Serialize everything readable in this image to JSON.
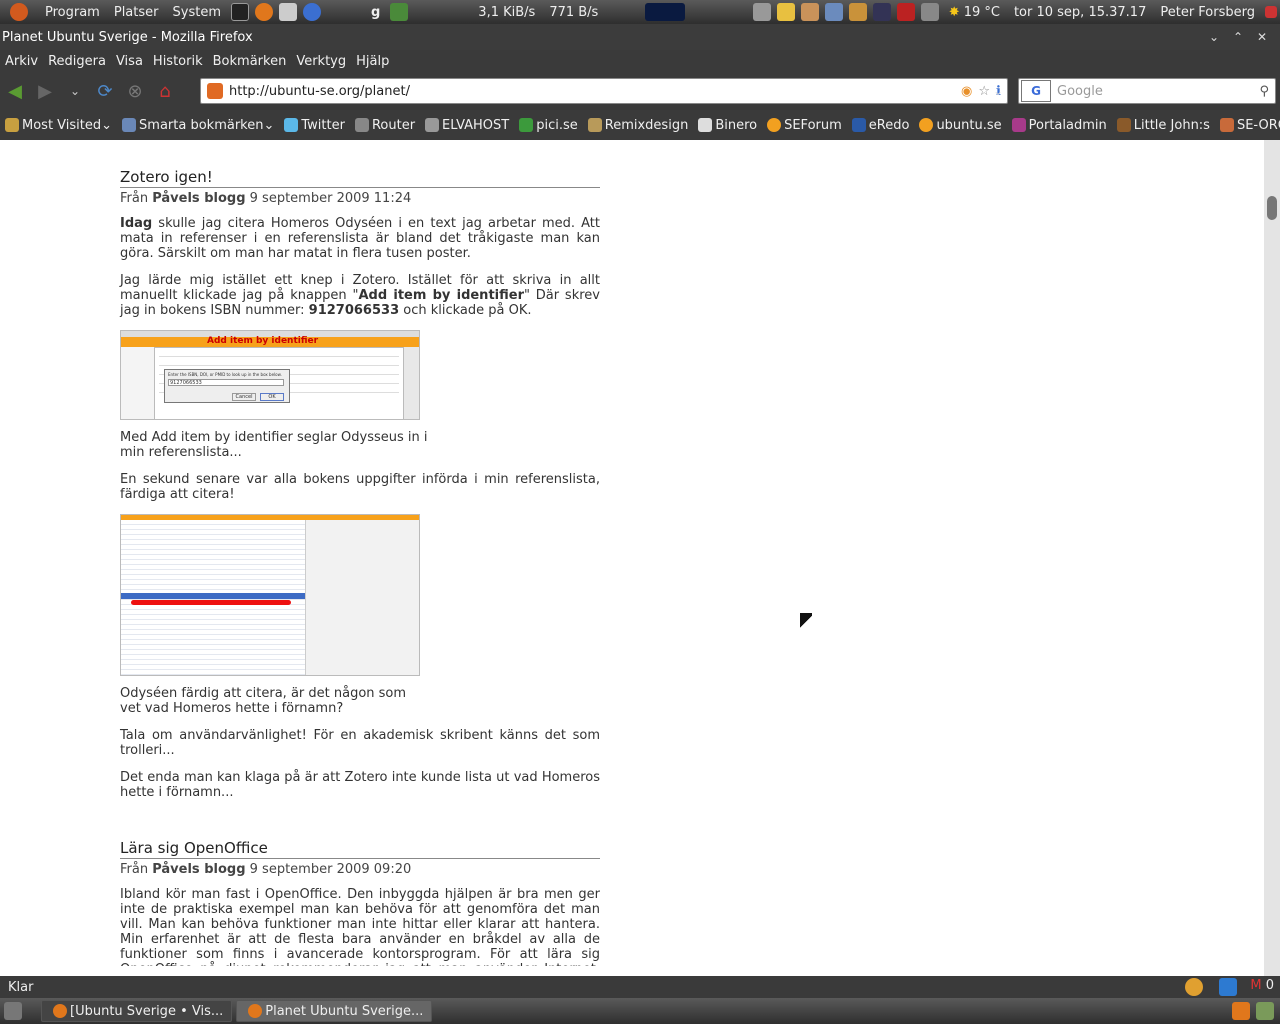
{
  "top_panel": {
    "menu_program": "Program",
    "menu_places": "Platser",
    "menu_system": "System",
    "net_down": "3,1 KiB/s",
    "net_up": "771 B/s",
    "weather": "19 °C",
    "clock": "tor 10 sep, 15.37.17",
    "user": "Peter Forsberg"
  },
  "window": {
    "title": "Planet Ubuntu Sverige - Mozilla Firefox"
  },
  "menubar": {
    "items": [
      "Arkiv",
      "Redigera",
      "Visa",
      "Historik",
      "Bokmärken",
      "Verktyg",
      "Hjälp"
    ]
  },
  "navbar": {
    "url": "http://ubuntu-se.org/planet/",
    "search_placeholder": "Google"
  },
  "bookmarks": [
    "Most Visited",
    "Smarta bokmärken",
    "Twitter",
    "Router",
    "ELVAHOST",
    "pici.se",
    "Remixdesign",
    "Binero",
    "SEForum",
    "eRedo",
    "ubuntu.se",
    "Portaladmin",
    "Little John:s",
    "SE-ORG"
  ],
  "posts": [
    {
      "title": "Zotero igen!",
      "from": "Från",
      "author": "Påvels blogg",
      "date": "9 september 2009 11:24",
      "p1_lead": "Idag",
      "p1": " skulle jag citera Homeros Odyséen i en text jag arbetar med. Att mata in referenser i en referenslista är bland det tråkigaste man kan göra. Särskilt om man har matat in flera tusen poster.",
      "p2a": "Jag lärde mig istället ett knep i Zotero. Istället för att skriva in allt manuellt klickade jag på knappen \"",
      "p2b": "Add item by identifier",
      "p2c": "\" Där skrev jag in bokens ISBN nummer: ",
      "p2d": "9127066533",
      "p2e": " och klickade på OK.",
      "img1_label": "Add item by identifier",
      "img1_dialog": "Enter the ISBN, DOI, or PMID to look up in the box below.",
      "img1_isbn": "9127066533",
      "img1_cancel": "Cancel",
      "img1_ok": "OK",
      "caption1": "Med Add item by identifier seglar Odysseus in i min referenslista...",
      "p3": "En sekund senare var alla bokens uppgifter införda i min referenslista, färdiga att citera!",
      "caption2": "Odyséen färdig att citera, är det någon som vet vad Homeros hette i förnamn?",
      "p4": "Tala om användarvänlighet! För en akademisk skribent känns det som trolleri...",
      "p5": "Det enda man kan klaga på är att Zotero inte kunde lista ut vad Homeros hette i förnamn..."
    },
    {
      "title": "Lära sig OpenOffice",
      "from": "Från",
      "author": "Påvels blogg",
      "date": "9 september 2009 09:20",
      "p1": "Ibland kör man fast i OpenOffice. Den inbyggda hjälpen är bra men ger inte de praktiska exempel man kan behöva för att genomföra det man vill. Man kan behöva funktioner man inte hittar eller klarar att hantera. Min erfarenhet är att de flesta bara använder en bråkdel av alla de funktioner som finns i avancerade kontorsprogram. För att lära sig OpenOffice på djupet rekommenderar jag att man använder Internet. Tyvärr finns det bara"
    }
  ],
  "statusbar": {
    "text": "Klar",
    "mail_count": "0"
  },
  "taskbar": {
    "tasks": [
      "[Ubuntu Sverige • Vis...",
      "Planet Ubuntu Sverige..."
    ]
  },
  "colors": {
    "panel": "#3a3a3a",
    "accent_orange": "#e06a24"
  }
}
